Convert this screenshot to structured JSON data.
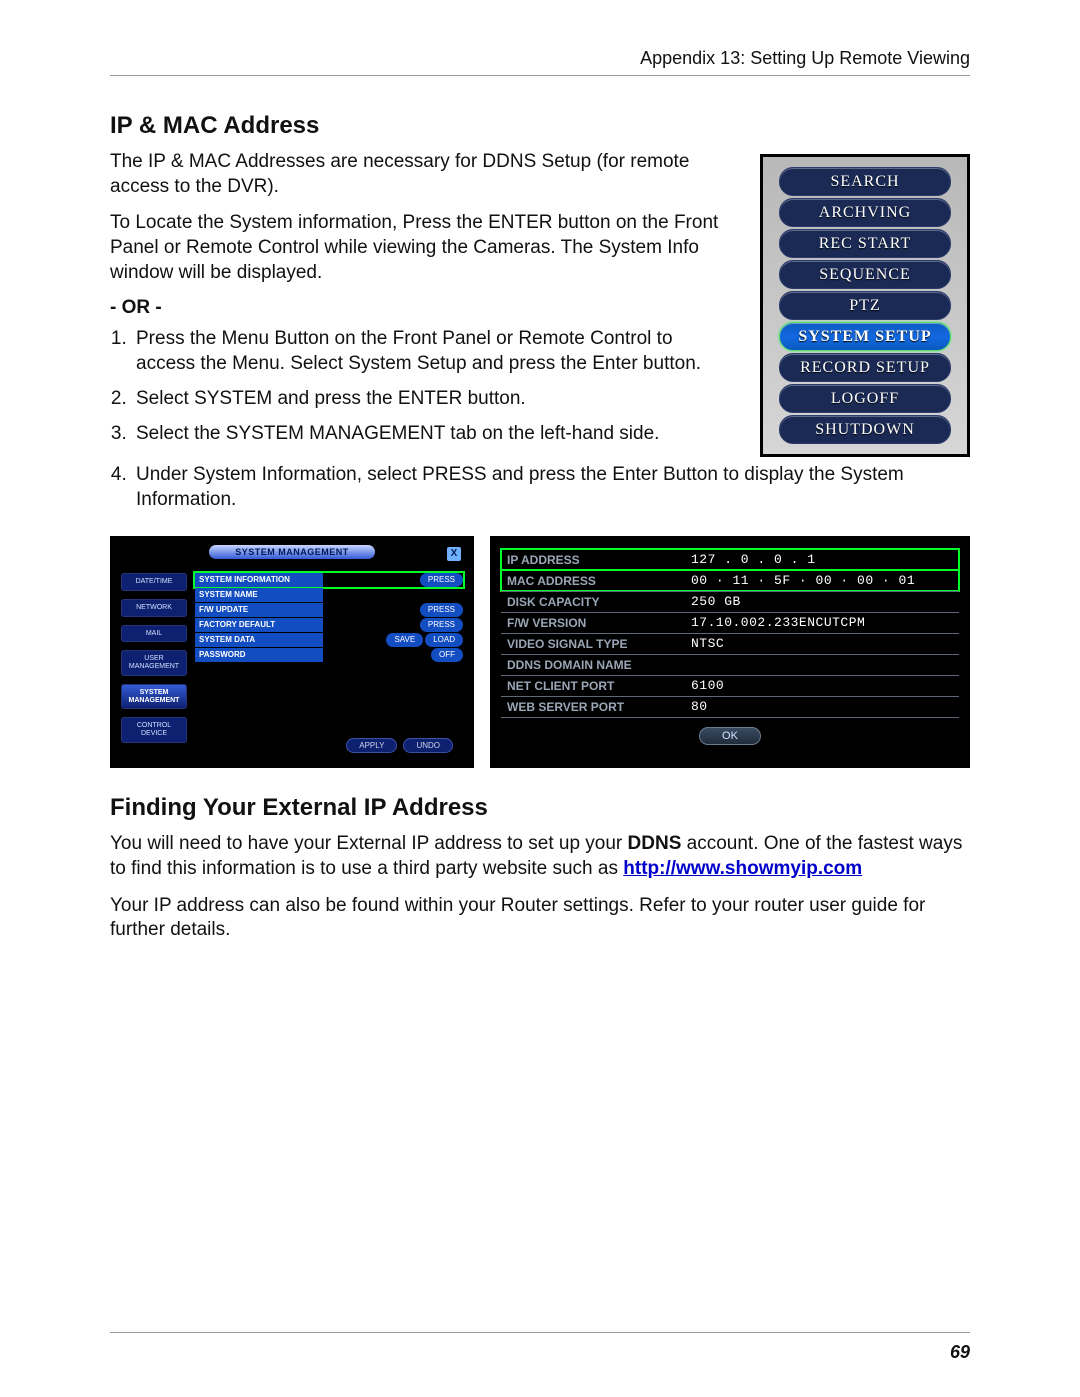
{
  "header": "Appendix 13: Setting Up Remote Viewing",
  "page_number": "69",
  "section1": {
    "title": "IP & MAC Address",
    "p1": "The IP & MAC Addresses are necessary for DDNS Setup (for remote access to the DVR).",
    "p2": "To Locate the System information, Press the ENTER button on the Front Panel or Remote Control while viewing the Cameras. The System Info window will be displayed.",
    "or": "- OR -",
    "steps": [
      "Press the Menu Button on the Front Panel or Remote Control to access the Menu. Select System Setup and press the Enter button.",
      "Select SYSTEM and press the ENTER button.",
      "Select the SYSTEM MANAGEMENT tab on the left-hand side.",
      "Under System Information, select PRESS and press the Enter Button to display the System Information."
    ]
  },
  "menu": {
    "items": [
      {
        "label": "SEARCH",
        "sel": false
      },
      {
        "label": "ARCHVING",
        "sel": false
      },
      {
        "label": "REC START",
        "sel": false
      },
      {
        "label": "SEQUENCE",
        "sel": false
      },
      {
        "label": "PTZ",
        "sel": false
      },
      {
        "label": "SYSTEM SETUP",
        "sel": true
      },
      {
        "label": "RECORD SETUP",
        "sel": false
      },
      {
        "label": "LOGOFF",
        "sel": false
      },
      {
        "label": "SHUTDOWN",
        "sel": false
      }
    ]
  },
  "shotA": {
    "title": "SYSTEM MANAGEMENT",
    "close": "X",
    "tabs": [
      {
        "label": "DATE/TIME",
        "sel": false
      },
      {
        "label": "NETWORK",
        "sel": false
      },
      {
        "label": "MAIL",
        "sel": false
      },
      {
        "label": "USER\nMANAGEMENT",
        "sel": false
      },
      {
        "label": "SYSTEM\nMANAGEMENT",
        "sel": true
      },
      {
        "label": "CONTROL\nDEVICE",
        "sel": false
      }
    ],
    "rows": [
      {
        "label": "SYSTEM INFORMATION",
        "val": "PRESS",
        "hi": true
      },
      {
        "label": "SYSTEM NAME",
        "val": "",
        "hi": false
      },
      {
        "label": "F/W UPDATE",
        "val": "PRESS",
        "hi": false
      },
      {
        "label": "FACTORY DEFAULT",
        "val": "PRESS",
        "hi": false
      },
      {
        "label": "SYSTEM DATA",
        "val": "SAVE",
        "val2": "LOAD",
        "hi": false
      },
      {
        "label": "PASSWORD",
        "val": "OFF",
        "hi": false
      }
    ],
    "apply": "APPLY",
    "undo": "UNDO"
  },
  "shotB": {
    "rows": [
      {
        "label": "IP ADDRESS",
        "val": "127 . 0 . 0 . 1",
        "hi": true
      },
      {
        "label": "MAC ADDRESS",
        "val": "00 · 11 · 5F · 00 · 00 · 01",
        "hi": true
      },
      {
        "label": "DISK CAPACITY",
        "val": "250 GB",
        "hi": false
      },
      {
        "label": "F/W VERSION",
        "val": "17.10.002.233ENCUTCPM",
        "hi": false
      },
      {
        "label": "VIDEO SIGNAL TYPE",
        "val": "NTSC",
        "hi": false
      },
      {
        "label": "DDNS DOMAIN NAME",
        "val": "",
        "hi": false
      },
      {
        "label": "NET CLIENT PORT",
        "val": "6100",
        "hi": false
      },
      {
        "label": "WEB SERVER PORT",
        "val": "80",
        "hi": false
      }
    ],
    "ok": "OK"
  },
  "section2": {
    "title": "Finding Your External IP Address",
    "p1a": "You will need to have your External IP address to set up your ",
    "p1b": "DDNS",
    "p1c": " account. One of the fastest ways to find this information is to use a third party website such as ",
    "link": "http://www.showmyip.com",
    "p2": "Your IP address can also be found within your Router settings. Refer to your router user guide for further details."
  }
}
